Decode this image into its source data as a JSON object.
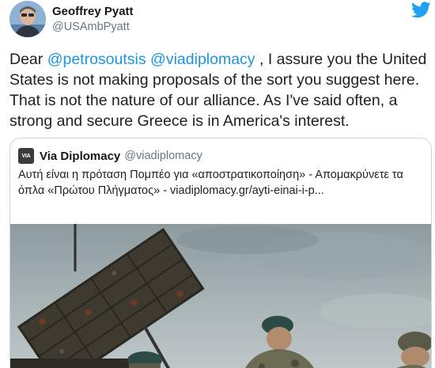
{
  "tweet": {
    "author_name": "Geoffrey Pyatt",
    "author_handle": "@USAmbPyatt",
    "text_prefix": "Dear ",
    "mention_1": "@petrosoutsis",
    "text_space": " ",
    "mention_2": "@viadiplomacy",
    "text_body": " , I assure you the United States is not making proposals of the sort you suggest here. That is not the nature of our alliance. As I've said often, a strong and secure Greece is in America's interest."
  },
  "quoted_tweet": {
    "avatar_text": "VIA",
    "author_name": "Via Diplomacy",
    "author_handle": "@viadiplomacy",
    "text": "Αυτή είναι η πρόταση Πομπέο για «αποστρατικοποίηση» - Απομακρύνετε τα όπλα «Πρώτου Πλήγματος» - viadiplomacy.gr/ayti-einai-i-p..."
  },
  "icons": {
    "brand": "twitter-bird-icon"
  },
  "colors": {
    "link": "#1b95e0",
    "brand": "#1da1f2",
    "secondary_text": "#657786",
    "border": "#ccd6dd"
  }
}
